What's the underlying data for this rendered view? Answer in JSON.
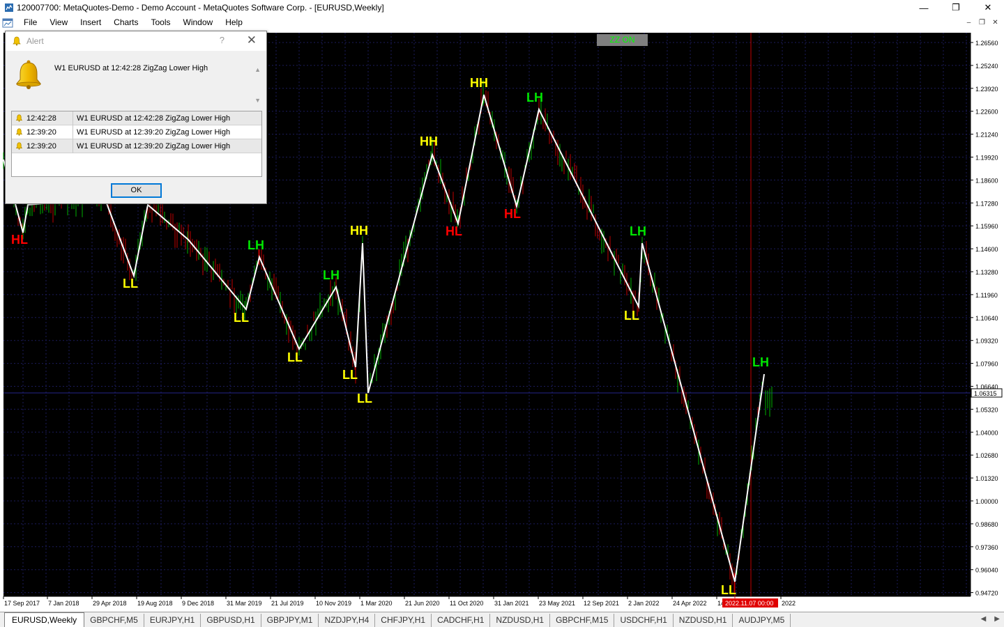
{
  "window": {
    "title": "120007700: MetaQuotes-Demo - Demo Account - MetaQuotes Software Corp. - [EURUSD,Weekly]",
    "minimize": "—",
    "maximize": "❐",
    "close": "✕"
  },
  "menu": {
    "items": [
      "File",
      "View",
      "Insert",
      "Charts",
      "Tools",
      "Window",
      "Help"
    ]
  },
  "chart": {
    "zz_button": "ZZ ON",
    "current_price": "1.06315",
    "price_labels": [
      "1.26560",
      "1.25240",
      "1.23920",
      "1.22600",
      "1.21240",
      "1.19920",
      "1.18600",
      "1.17280",
      "1.15960",
      "1.14600",
      "1.13280",
      "1.11960",
      "1.10640",
      "1.09320",
      "1.07960",
      "1.06640",
      "1.05320",
      "1.04000",
      "1.02680",
      "1.01320",
      "1.00000",
      "0.98680",
      "0.97360",
      "0.96040",
      "0.94720"
    ],
    "date_labels": [
      "17 Sep 2017",
      "7 Jan 2018",
      "29 Apr 2018",
      "19 Aug 2018",
      "9 Dec 2018",
      "31 Mar 2019",
      "21 Jul 2019",
      "10 Nov 2019",
      "1 Mar 2020",
      "21 Jun 2020",
      "11 Oct 2020",
      "31 Jan 2021",
      "23 May 2021",
      "12 Sep 2021",
      "2 Jan 2022",
      "24 Apr 2022",
      "14",
      "2022"
    ],
    "cursor_date": "2022.11.07 00:00",
    "colors": {
      "background": "#000000",
      "grid": "#1c1c5c",
      "bull": "#00b000",
      "bear": "#c00000",
      "zigzag": "#ffffff",
      "label_yellow": "#ffff00",
      "label_green": "#00e600",
      "label_red": "#ff0000"
    },
    "zigzag_labels": [
      {
        "text": "HL",
        "color": "red"
      },
      {
        "text": "LL",
        "color": "yellow"
      },
      {
        "text": "LH",
        "color": "green"
      },
      {
        "text": "LL",
        "color": "yellow"
      },
      {
        "text": "LH",
        "color": "green"
      },
      {
        "text": "LL",
        "color": "yellow"
      },
      {
        "text": "LL",
        "color": "yellow"
      },
      {
        "text": "HH",
        "color": "yellow"
      },
      {
        "text": "LL",
        "color": "yellow"
      },
      {
        "text": "HH",
        "color": "yellow"
      },
      {
        "text": "HL",
        "color": "red"
      },
      {
        "text": "HH",
        "color": "yellow"
      },
      {
        "text": "HL",
        "color": "red"
      },
      {
        "text": "LH",
        "color": "green"
      },
      {
        "text": "LH",
        "color": "green"
      },
      {
        "text": "LL",
        "color": "yellow"
      },
      {
        "text": "LL",
        "color": "yellow"
      },
      {
        "text": "LH",
        "color": "green"
      }
    ]
  },
  "alert": {
    "title": "Alert",
    "help": "?",
    "close": "✕",
    "message": "W1 EURUSD at 12:42:28 ZigZag Lower High",
    "rows": [
      {
        "time": "12:42:28",
        "message": "W1 EURUSD at 12:42:28 ZigZag Lower High"
      },
      {
        "time": "12:39:20",
        "message": "W1 EURUSD at 12:39:20 ZigZag Lower High"
      },
      {
        "time": "12:39:20",
        "message": "W1 EURUSD at 12:39:20 ZigZag Lower High"
      }
    ],
    "ok_label": "OK"
  },
  "tabs": [
    "EURUSD,Weekly",
    "GBPCHF,M5",
    "EURJPY,H1",
    "GBPUSD,H1",
    "GBPJPY,M1",
    "NZDJPY,H4",
    "CHFJPY,H1",
    "CADCHF,H1",
    "NZDUSD,H1",
    "GBPCHF,M15",
    "USDCHF,H1",
    "NZDUSD,H1",
    "AUDJPY,M5"
  ]
}
